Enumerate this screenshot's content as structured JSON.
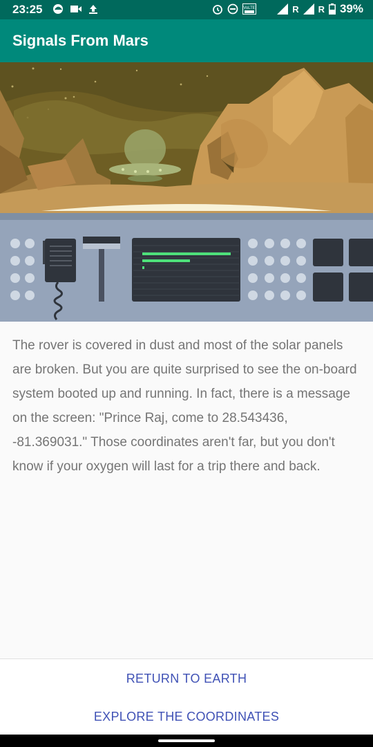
{
  "status_bar": {
    "time": "23:25",
    "battery": "39%",
    "left_icons": [
      "edge-icon",
      "video-icon",
      "upload-icon"
    ],
    "right_icons": [
      "alarm-icon",
      "dnd-icon",
      "volte-icon",
      "wifi-icon",
      "signal-icon",
      "signal-icon"
    ],
    "roaming_1": "R",
    "roaming_2": "R",
    "volte_label": "VoLTE"
  },
  "app_bar": {
    "title": "Signals From Mars",
    "color": "#00897b",
    "dark_color": "#00695c"
  },
  "hero": {
    "illustration": "mars-rover-console-illustration"
  },
  "story": {
    "text": "The rover is covered in dust and most of the solar panels are broken. But you are quite surprised to see the on-board system booted up and running. In fact, there is a message on the screen: \"Prince Raj, come to 28.543436, -81.369031.\" Those coordinates aren't far, but you don't know if your oxygen will last for a trip there and back."
  },
  "actions": {
    "return_label": "RETURN TO EARTH",
    "explore_label": "EXPLORE THE COORDINATES",
    "accent": "#3f51b5"
  }
}
